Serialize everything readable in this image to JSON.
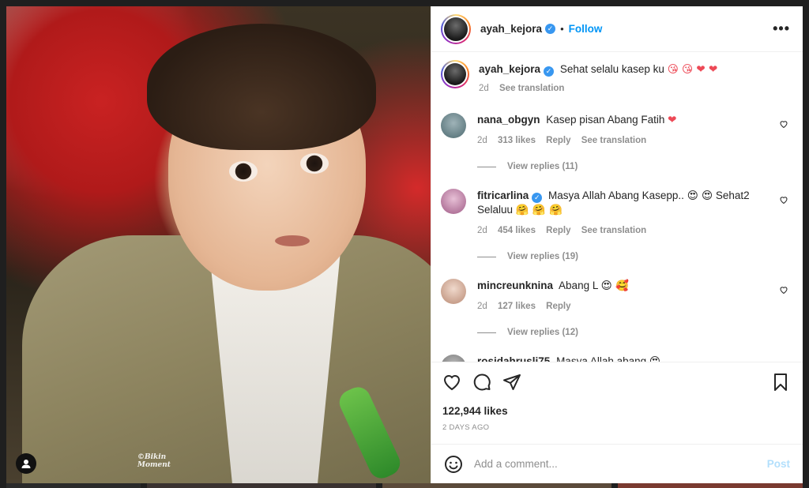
{
  "header": {
    "username": "ayah_kejora",
    "dot": "•",
    "follow_label": "Follow",
    "more_icon": "•••"
  },
  "photo": {
    "watermark_line1": "©Bikin",
    "watermark_line2": "Moment"
  },
  "caption": {
    "username": "ayah_kejora",
    "text": "Sehat selalu kasep ku",
    "emojis": "😘 😘 ❤ ❤",
    "time": "2d",
    "see_translation": "See translation"
  },
  "comments": [
    {
      "username": "nana_obgyn",
      "text": "Kasep pisan Abang Fatih",
      "emoji": "❤",
      "time": "2d",
      "likes": "313 likes",
      "reply": "Reply",
      "see_translation": "See translation",
      "view_replies": "View replies (11)"
    },
    {
      "username": "fitricarlina",
      "text": "Masya Allah Abang Kasepp..",
      "emoji1": "😍 😍",
      "text2": "Sehat2 Selaluu",
      "emoji2": "🤗 🤗 🤗",
      "time": "2d",
      "likes": "454 likes",
      "reply": "Reply",
      "see_translation": "See translation",
      "view_replies": "View replies (19)"
    },
    {
      "username": "mincreunknina",
      "text": "Abang L",
      "emoji": "😍 🥰",
      "time": "2d",
      "likes": "127 likes",
      "reply": "Reply",
      "view_replies": "View replies (12)"
    },
    {
      "username": "rosidahrusli75",
      "text": "Masya Allah abang",
      "emoji": "😍"
    }
  ],
  "actions": {
    "likes": "122,944 likes",
    "time_ago": "2 DAYS AGO"
  },
  "add_comment": {
    "placeholder": "Add a comment...",
    "post_label": "Post"
  }
}
